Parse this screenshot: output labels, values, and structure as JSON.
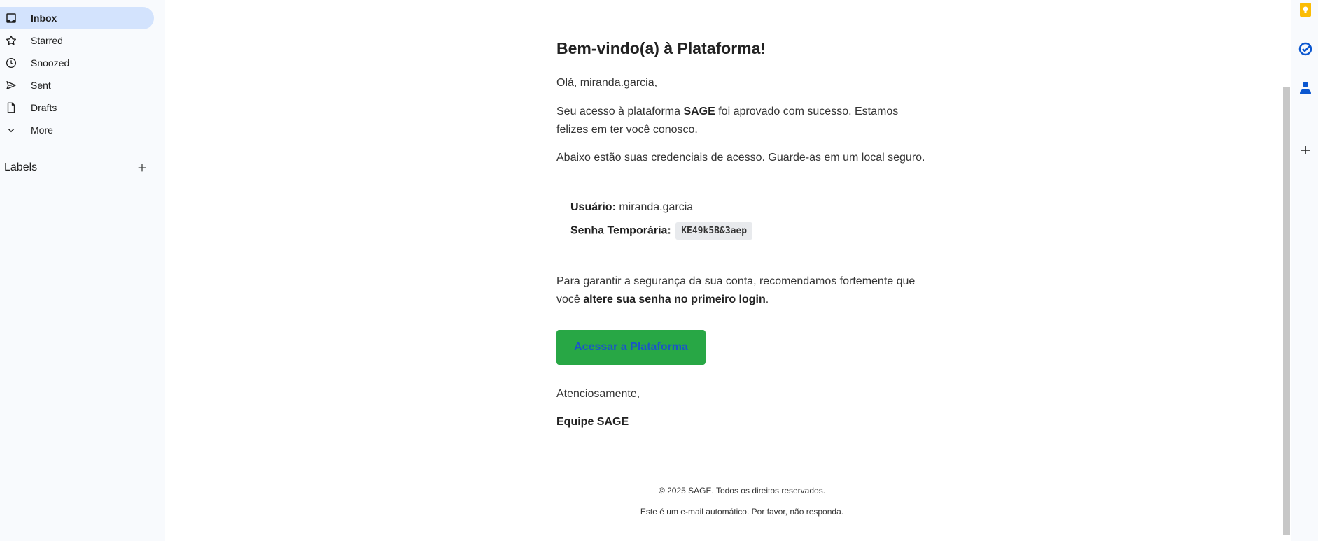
{
  "sidebar": {
    "items": [
      {
        "label": "Inbox",
        "icon": "inbox-icon"
      },
      {
        "label": "Starred",
        "icon": "star-icon"
      },
      {
        "label": "Snoozed",
        "icon": "clock-icon"
      },
      {
        "label": "Sent",
        "icon": "send-icon"
      },
      {
        "label": "Drafts",
        "icon": "draft-icon"
      },
      {
        "label": "More",
        "icon": "chevron-down-icon"
      }
    ],
    "labels_title": "Labels"
  },
  "email": {
    "heading": "Bem-vindo(a) à Plataforma!",
    "greeting": "Olá, miranda.garcia,",
    "intro_before": "Seu acesso à plataforma ",
    "intro_brand": "SAGE",
    "intro_after": " foi aprovado com sucesso. Estamos",
    "intro_line2": "felizes em ter você conosco.",
    "credentials_note": "Abaixo estão suas credenciais de acesso. Guarde-as em um local seguro.",
    "user_label": "Usuário:",
    "user_value": " miranda.garcia",
    "password_label": "Senha Temporária:",
    "password_value": "KE49k5B&3aep",
    "security_line1": "Para garantir a segurança da sua conta, recomendamos fortemente que",
    "security_line2_before": "você ",
    "security_line2_bold": "altere sua senha no primeiro login",
    "security_line2_after": ".",
    "cta_label": "Acessar a Plataforma",
    "signoff": "Atenciosamente,",
    "signature": "Equipe SAGE",
    "footer_copyright": "© 2025 SAGE. Todos os direitos reservados.",
    "footer_note": "Este é um e-mail automático. Por favor, não responda."
  },
  "colors": {
    "nav_active_bg": "#d3e3fd",
    "cta_bg": "#28a745",
    "cta_text": "#1a54c9",
    "keep_yellow": "#fbbc04",
    "tasks_blue": "#0b57d0"
  },
  "rightbar": {
    "icons": [
      "keep-icon",
      "tasks-icon",
      "contacts-icon",
      "add-addon-icon"
    ]
  }
}
